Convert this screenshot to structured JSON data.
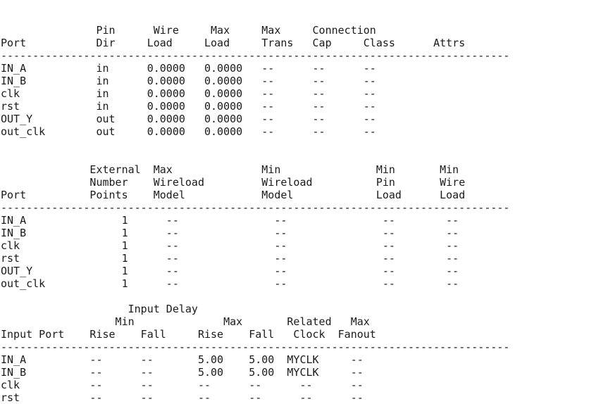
{
  "report": {
    "lines": [
      "               Pin      Wire     Max     Max     Connection",
      "Port           Dir     Load     Load     Trans   Cap     Class      Attrs",
      "--------------------------------------------------------------------------------",
      "IN_A           in      0.0000   0.0000   --      --      --",
      "IN_B           in      0.0000   0.0000   --      --      --",
      "clk            in      0.0000   0.0000   --      --      --",
      "rst            in      0.0000   0.0000   --      --      --",
      "OUT_Y          out     0.0000   0.0000   --      --      --",
      "out_clk        out     0.0000   0.0000   --      --      --",
      "",
      "",
      "              External  Max              Min               Min       Min",
      "              Number    Wireload         Wireload          Pin       Wire",
      "Port          Points    Model            Model             Load      Load",
      "--------------------------------------------------------------------------------",
      "IN_A               1      --               --               --        --",
      "IN_B               1      --               --               --        --",
      "clk                1      --               --               --        --",
      "rst                1      --               --               --        --",
      "OUT_Y              1      --               --               --        --",
      "out_clk            1      --               --               --        --",
      "",
      "                    Input Delay",
      "                  Min              Max       Related   Max",
      "Input Port    Rise    Fall     Rise    Fall   Clock  Fanout",
      "--------------------------------------------------------------------------------",
      "IN_A          --      --       5.00    5.00  MYCLK     --",
      "IN_B          --      --       5.00    5.00  MYCLK     --",
      "clk           --      --       --      --      --      --",
      "rst           --      --       --      --      --      --"
    ]
  }
}
